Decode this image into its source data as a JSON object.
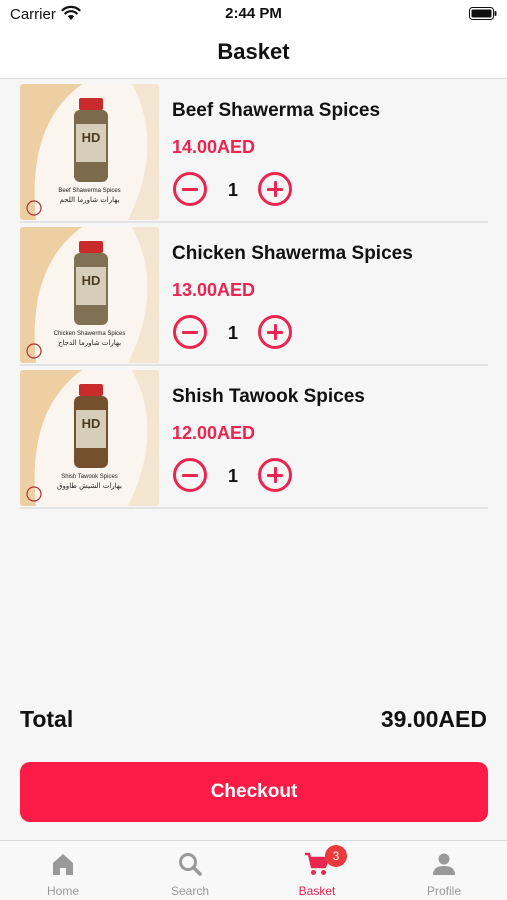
{
  "status_bar": {
    "carrier": "Carrier",
    "time": "2:44 PM"
  },
  "header": {
    "title": "Basket"
  },
  "cart": {
    "items": [
      {
        "name": "Beef Shawerma Spices",
        "price": "14.00AED",
        "quantity": "1",
        "image": {
          "brand": "HD",
          "label_en": "Beef Shawerma Spices",
          "label_ar": "بهارات شاورما اللحم"
        }
      },
      {
        "name": "Chicken Shawerma Spices",
        "price": "13.00AED",
        "quantity": "1",
        "image": {
          "brand": "HD",
          "label_en": "Chicken Shawerma Spices",
          "label_ar": "بهارات شاورما الدجاج"
        }
      },
      {
        "name": "Shish Tawook Spices",
        "price": "12.00AED",
        "quantity": "1",
        "image": {
          "brand": "HD",
          "label_en": "Shish Tawook Spices",
          "label_ar": "بهارات الشيش طاووق"
        }
      }
    ]
  },
  "summary": {
    "total_label": "Total",
    "total_value": "39.00AED"
  },
  "checkout": {
    "label": "Checkout"
  },
  "tab_bar": {
    "tabs": [
      {
        "label": "Home",
        "icon": "home-icon",
        "active": false
      },
      {
        "label": "Search",
        "icon": "search-icon",
        "active": false
      },
      {
        "label": "Basket",
        "icon": "cart-icon",
        "active": true,
        "badge": "3"
      },
      {
        "label": "Profile",
        "icon": "person-icon",
        "active": false
      }
    ]
  },
  "colors": {
    "accent": "#ea2550",
    "checkout_button": "#fc1a47",
    "badge": "#ea3a3a",
    "inactive_tab": "#999999"
  }
}
